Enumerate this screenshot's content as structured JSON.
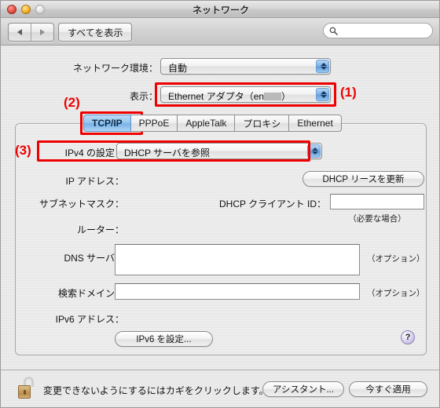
{
  "window": {
    "title": "ネットワーク",
    "traffic_lights": [
      "close-button",
      "minimize-button",
      "zoom-button"
    ]
  },
  "toolbar": {
    "back_icon": "triangle-left-icon",
    "forward_icon": "triangle-right-icon",
    "show_all_label": "すべてを表示",
    "search": {
      "value": "",
      "placeholder": "",
      "icon": "search-icon"
    }
  },
  "form": {
    "location_label": "ネットワーク環境：",
    "location_value": "自動",
    "show_label": "表示：",
    "show_value_prefix": "Ethernet アダプタ（en",
    "show_value_suffix": "）"
  },
  "tabs": [
    {
      "label": "TCP/IP",
      "active": true
    },
    {
      "label": "PPPoE",
      "active": false
    },
    {
      "label": "AppleTalk",
      "active": false
    },
    {
      "label": "プロキシ",
      "active": false
    },
    {
      "label": "Ethernet",
      "active": false
    }
  ],
  "panel": {
    "ipv4_label": "IPv4 の設定：",
    "ipv4_value": "DHCP サーバを参照",
    "ip_address_label": "IP アドレス：",
    "ip_address_value": "",
    "subnet_label": "サブネットマスク：",
    "subnet_value": "",
    "router_label": "ルーター：",
    "router_value": "",
    "dns_label": "DNS サーバ：",
    "dns_value": "",
    "dns_option_note": "（オプション）",
    "search_domain_label": "検索ドメイン：",
    "search_domain_value": "",
    "search_domain_option_note": "（オプション）",
    "dhcp_renew_button": "DHCP リースを更新",
    "dhcp_client_id_label": "DHCP クライアント ID：",
    "dhcp_client_id_value": "",
    "dhcp_client_id_note": "（必要な場合）",
    "ipv6_address_label": "IPv6 アドレス：",
    "ipv6_address_value": "",
    "ipv6_configure_button": "IPv6 を設定...",
    "help_button": "?"
  },
  "bottom": {
    "lock_icon": "unlocked-padlock-icon",
    "lock_message": "変更できないようにするにはカギをクリックします。",
    "assistant_button": "アシスタント...",
    "apply_button": "今すぐ適用"
  },
  "annotations": [
    {
      "id": "1",
      "label": "(1)"
    },
    {
      "id": "2",
      "label": "(2)"
    },
    {
      "id": "3",
      "label": "(3)"
    }
  ],
  "colors": {
    "annotation_red": "#ee0000",
    "tab_active_blue": "#7ab2e8",
    "popup_arrow_blue": "#5f9cdd",
    "help_purple": "#b5a9dd"
  }
}
